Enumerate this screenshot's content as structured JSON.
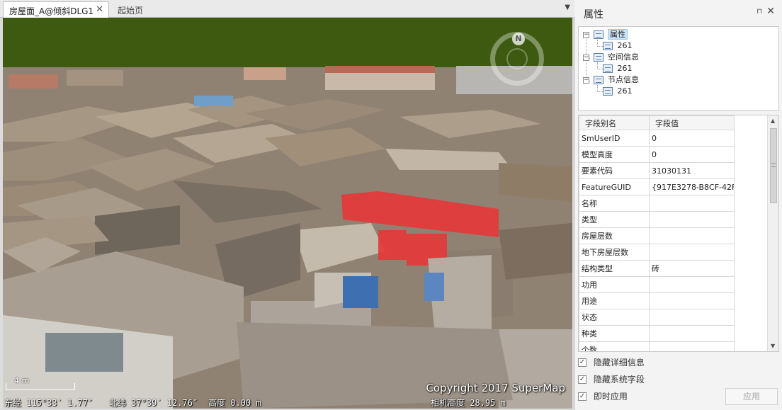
{
  "document": {
    "tabs": [
      {
        "label": "房屋面_A@倾斜DLG1",
        "active": true
      },
      {
        "label": "起始页",
        "active": false
      }
    ],
    "close_glyph": "✕",
    "menu_glyph": "▼",
    "scene": {
      "copyright": "Copyright 2017 SuperMap",
      "scale_label": "4 m",
      "compass_label": "N",
      "status": {
        "longitude": "东经 115°33′ 1.77″",
        "latitude": "北纬 37°39′ 12.76″",
        "height": "高度 0.00 m",
        "camera_height": "相机高度 28.95 m"
      },
      "highlight_color": "#e53a3a",
      "sky_color": "#3d5a10"
    }
  },
  "panel": {
    "title": "属性",
    "pin_glyph": "⊓",
    "close_glyph": "✕",
    "tree": [
      {
        "label": "属性",
        "child": "261",
        "selected": true,
        "icon": "table-icon"
      },
      {
        "label": "空间信息",
        "child": "261",
        "selected": false,
        "icon": "geometry-icon"
      },
      {
        "label": "节点信息",
        "child": "261",
        "selected": false,
        "icon": "node-icon"
      }
    ],
    "expander_glyph": "−",
    "grid": {
      "headers": [
        "字段别名",
        "字段值"
      ],
      "rows": [
        [
          "SmUserID",
          "0"
        ],
        [
          "模型高度",
          "0"
        ],
        [
          "要素代码",
          "31030131"
        ],
        [
          "FeatureGUID",
          "{917E3278-B8CF-42F..."
        ],
        [
          "名称",
          ""
        ],
        [
          "类型",
          ""
        ],
        [
          "房屋层数",
          ""
        ],
        [
          "地下房屋层数",
          ""
        ],
        [
          "结构类型",
          "砖"
        ],
        [
          "功用",
          ""
        ],
        [
          "用途",
          ""
        ],
        [
          "状态",
          ""
        ],
        [
          "种类",
          ""
        ],
        [
          "个数",
          ""
        ]
      ]
    },
    "scroll_up_glyph": "▲",
    "scroll_down_glyph": "▼",
    "options": [
      {
        "label": "隐藏详细信息",
        "checked": true
      },
      {
        "label": "隐藏系统字段",
        "checked": true
      },
      {
        "label": "即时应用",
        "checked": true
      }
    ],
    "check_glyph": "✓",
    "apply_label": "应用"
  }
}
